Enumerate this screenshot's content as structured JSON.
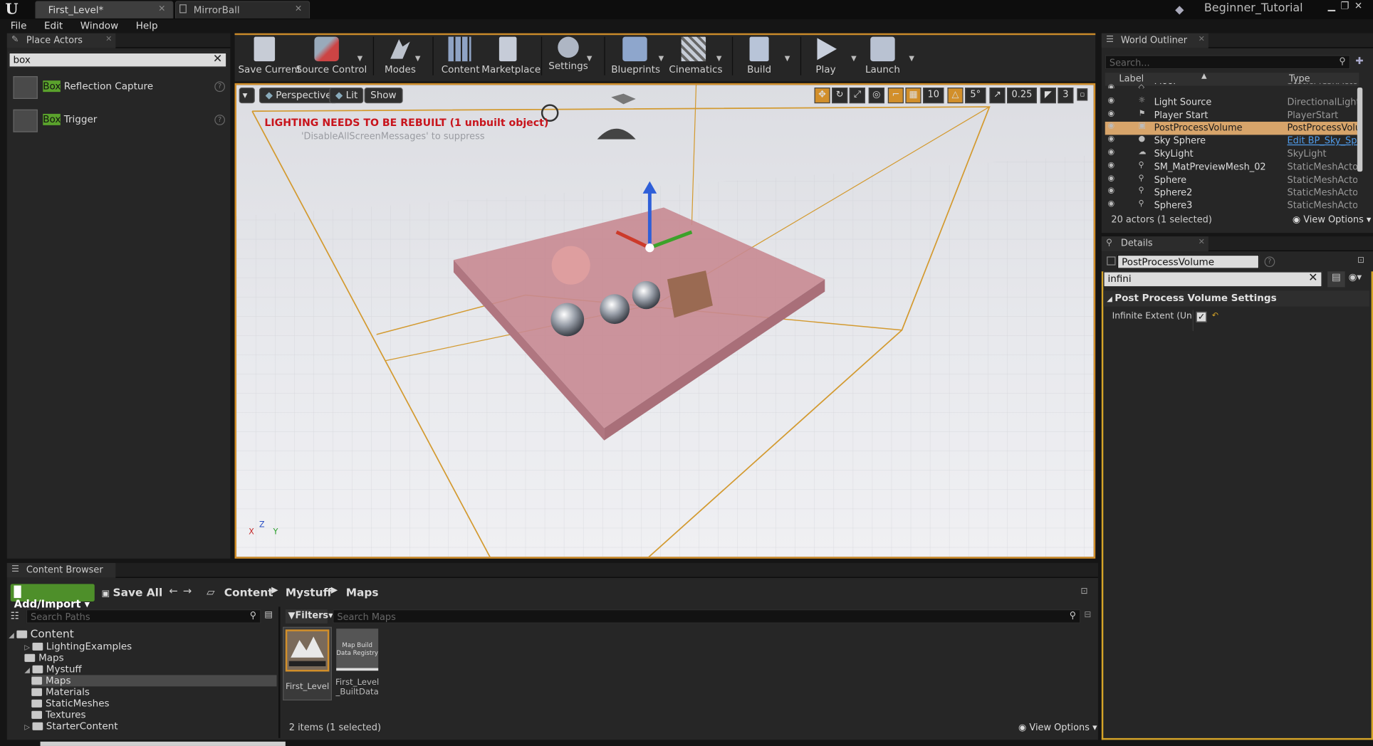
{
  "title_bar": {
    "tabs": [
      {
        "label": "First_Level*"
      },
      {
        "label": "MirrorBall"
      }
    ],
    "project_name": "Beginner_Tutorial"
  },
  "menu": {
    "items": [
      "File",
      "Edit",
      "Window",
      "Help"
    ]
  },
  "place_actors": {
    "tab_label": "Place Actors",
    "search_value": "box",
    "results": [
      {
        "highlight": "Box",
        "rest": " Reflection Capture"
      },
      {
        "highlight": "Box",
        "rest": " Trigger"
      }
    ]
  },
  "toolbar": {
    "buttons": [
      "Save Current",
      "Source Control",
      "Modes",
      "Content",
      "Marketplace",
      "Settings",
      "Blueprints",
      "Cinematics",
      "Build",
      "Play",
      "Launch"
    ]
  },
  "viewport": {
    "view_mode": "Perspective",
    "lighting": "Lit",
    "show": "Show",
    "grid_snap": "10",
    "rotation_snap": "5°",
    "scale_snap": "0.25",
    "camera_speed": "3",
    "warning": "LIGHTING NEEDS TO BE REBUILT (1 unbuilt object)",
    "suppress_hint": "'DisableAllScreenMessages' to suppress",
    "axis": {
      "x": "X",
      "y": "Y",
      "z": "Z"
    }
  },
  "world_outliner": {
    "tab_label": "World Outliner",
    "search_placeholder": "Search...",
    "col_label": "Label",
    "col_type": "Type",
    "rows": [
      {
        "name": "Floor",
        "type": "StaticMeshActor"
      },
      {
        "name": "Light Source",
        "type": "DirectionalLight"
      },
      {
        "name": "Player Start",
        "type": "PlayerStart"
      },
      {
        "name": "PostProcessVolume",
        "type": "PostProcessVolume",
        "selected": true
      },
      {
        "name": "Sky Sphere",
        "type": "Edit BP_Sky_Sphere"
      },
      {
        "name": "SkyLight",
        "type": "SkyLight"
      },
      {
        "name": "SM_MatPreviewMesh_02",
        "type": "StaticMeshActor"
      },
      {
        "name": "Sphere",
        "type": "StaticMeshActor"
      },
      {
        "name": "Sphere2",
        "type": "StaticMeshActor"
      },
      {
        "name": "Sphere3",
        "type": "StaticMeshActor"
      }
    ],
    "status": "20 actors (1 selected)",
    "view_options": "View Options"
  },
  "details": {
    "tab_label": "Details",
    "actor_name": "PostProcessVolume",
    "search_value": "infini",
    "section": "Post Process Volume Settings",
    "property_label": "Infinite Extent (Unbound)",
    "property_checked": true
  },
  "content_browser": {
    "tab_label": "Content Browser",
    "add_import": "Add/Import",
    "save_all": "Save All",
    "breadcrumbs": [
      "Content",
      "Mystuff",
      "Maps"
    ],
    "search_paths_placeholder": "Search Paths",
    "filters": "Filters",
    "search_maps_placeholder": "Search Maps",
    "tree": [
      {
        "label": "Content",
        "level": 0
      },
      {
        "label": "LightingExamples",
        "level": 1
      },
      {
        "label": "Maps",
        "level": 1
      },
      {
        "label": "Mystuff",
        "level": 1
      },
      {
        "label": "Maps",
        "level": 2,
        "selected": true
      },
      {
        "label": "Materials",
        "level": 2
      },
      {
        "label": "StaticMeshes",
        "level": 2
      },
      {
        "label": "Textures",
        "level": 2
      },
      {
        "label": "StarterContent",
        "level": 1
      }
    ],
    "assets": [
      {
        "name": "First_Level",
        "selected": true
      },
      {
        "name": "First_Level_BuiltData",
        "thumb_text": "Map Build Data Registry"
      }
    ],
    "status": "2 items (1 selected)",
    "view_options": "View Options"
  }
}
